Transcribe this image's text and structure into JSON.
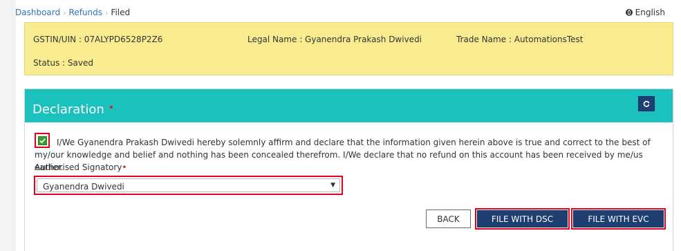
{
  "breadcrumb": {
    "items": [
      "Dashboard",
      "Refunds"
    ],
    "current": "Filed"
  },
  "language": {
    "label": "English",
    "icon": "globe-icon"
  },
  "taxpayer": {
    "gstin": "GSTIN/UIN : 07ALYPD6528P2Z6",
    "legal_name": "Legal Name : Gyanendra Prakash Dwivedi",
    "trade_name": "Trade Name : AutomationsTest",
    "status": "Status : Saved"
  },
  "declaration": {
    "title": "Declaration",
    "required_mark": "•",
    "refresh_icon": "refresh-icon",
    "checked": true,
    "text": "I/We Gyanendra Prakash Dwivedi hereby solemnly affirm and declare that the information given herein above is true and correct to the best of my/our knowledge and belief and nothing has been concealed therefrom. I/We declare that no refund on this account has been received by me/us earlier.",
    "signatory_label": "Authorised Signatory",
    "signatory_required": "•",
    "signatory_value": "Gyanendra Dwivedi"
  },
  "actions": {
    "back": "BACK",
    "file_dsc": "FILE WITH DSC",
    "file_evc": "FILE WITH EVC"
  },
  "colors": {
    "panel_header": "#1bc1bd",
    "info_box": "#f9ec90",
    "primary_button": "#1f3f73",
    "highlight_outline": "#e2001a",
    "link": "#2f76b7"
  }
}
